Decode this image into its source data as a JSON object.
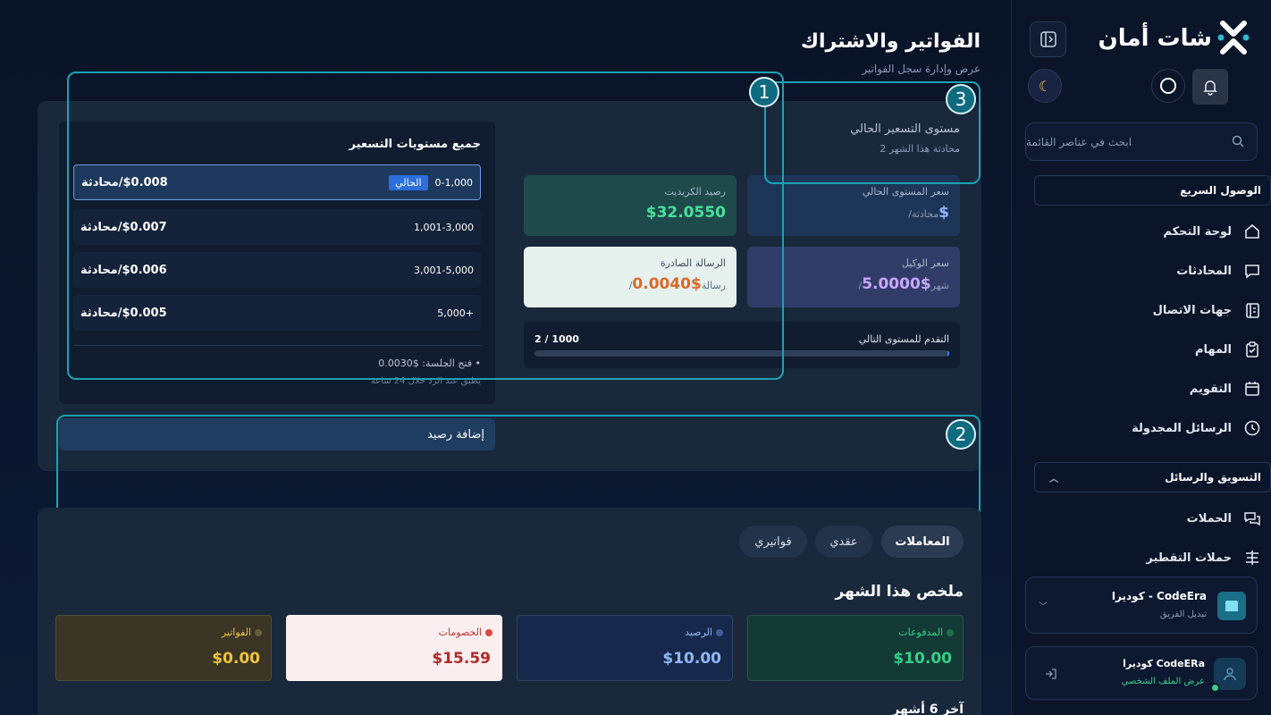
{
  "sidebar": {
    "logo_text": "شات أمان",
    "search_placeholder": "ابحث في عناصر القائمة",
    "quick_access": "الوصول السريع",
    "nav": [
      {
        "label": "لوحة التحكم",
        "icon": "home-icon"
      },
      {
        "label": "المحادثات",
        "icon": "chat-icon"
      },
      {
        "label": "جهات الاتصال",
        "icon": "contacts-icon"
      },
      {
        "label": "المهام",
        "icon": "clipboard-icon"
      },
      {
        "label": "التقويم",
        "icon": "calendar-icon"
      },
      {
        "label": "الرسائل المجدولة",
        "icon": "clock-icon"
      }
    ],
    "marketing_section": "التسويق والرسائل",
    "marketing_nav": [
      {
        "label": "الحملات",
        "icon": "campaigns-icon"
      },
      {
        "label": "حملات التقطير",
        "icon": "drip-icon"
      }
    ],
    "team": {
      "name": "كوديرا - CodeEra",
      "sub": "تبديل الفريق"
    },
    "profile": {
      "name": "كوديرا CodeERa",
      "sub": "عرض الملف الشخصي"
    }
  },
  "page": {
    "title": "الفواتير والاشتراك",
    "subtitle": "عرض وإدارة سجل الفواتير"
  },
  "pricing": {
    "current_level_title": "مستوى التسعير الحالي",
    "current_level_sub": "2 محادثة هذا الشهر",
    "tiers_title": "جميع مستويات التسعير",
    "current_badge": "الحالي",
    "tiers": [
      {
        "range": "0-1,000",
        "price": "$0.008/محادثة"
      },
      {
        "range": "1,001-3,000",
        "price": "$0.007/محادثة"
      },
      {
        "range": "3,001-5,000",
        "price": "$0.006/محادثة"
      },
      {
        "range": "5,000+",
        "price": "$0.005/محادثة"
      }
    ],
    "session_open": "• فتح الجلسة: $0.0030",
    "session_note": "يطبق عند الرد خلال 24 ساعة",
    "stats": {
      "credit_label": "رصيد الكريديت",
      "credit_value": "$32.0550",
      "current_rate_label": "سعر المستوى الحالي",
      "current_rate_value": "$",
      "current_rate_unit": "/محادثة",
      "outgoing_label": "الرسالة الصادرة",
      "outgoing_value": "$0.0040",
      "outgoing_unit": "/رسالة",
      "agent_label": "سعر الوكيل",
      "agent_value": "$5.0000",
      "agent_unit": "/شهر"
    },
    "progress_label": "التقدم للمستوى التالي",
    "progress_text": "2 / 1000",
    "progress_fraction": 0.002,
    "add_credit": "إضافة رصيد"
  },
  "overlays": {
    "one": "1",
    "two": "2",
    "three": "3"
  },
  "summary": {
    "tabs": [
      "المعاملات",
      "عقدي",
      "فواتيري"
    ],
    "title": "ملخص هذا الشهر",
    "cards": [
      {
        "label": "المدفوعات",
        "value": "$10.00"
      },
      {
        "label": "الرصيد",
        "value": "$10.00"
      },
      {
        "label": "الخصومات",
        "value": "$15.59"
      },
      {
        "label": "الفواتير",
        "value": "$0.00"
      }
    ],
    "last_months": "آخر 6 أشهر"
  },
  "colors": {
    "accent": "#1aa3b5",
    "green": "#35d08a",
    "blue": "#8fb8ff",
    "red": "#c03a3a",
    "yellow": "#f2c33c",
    "orange": "#d8692e"
  }
}
